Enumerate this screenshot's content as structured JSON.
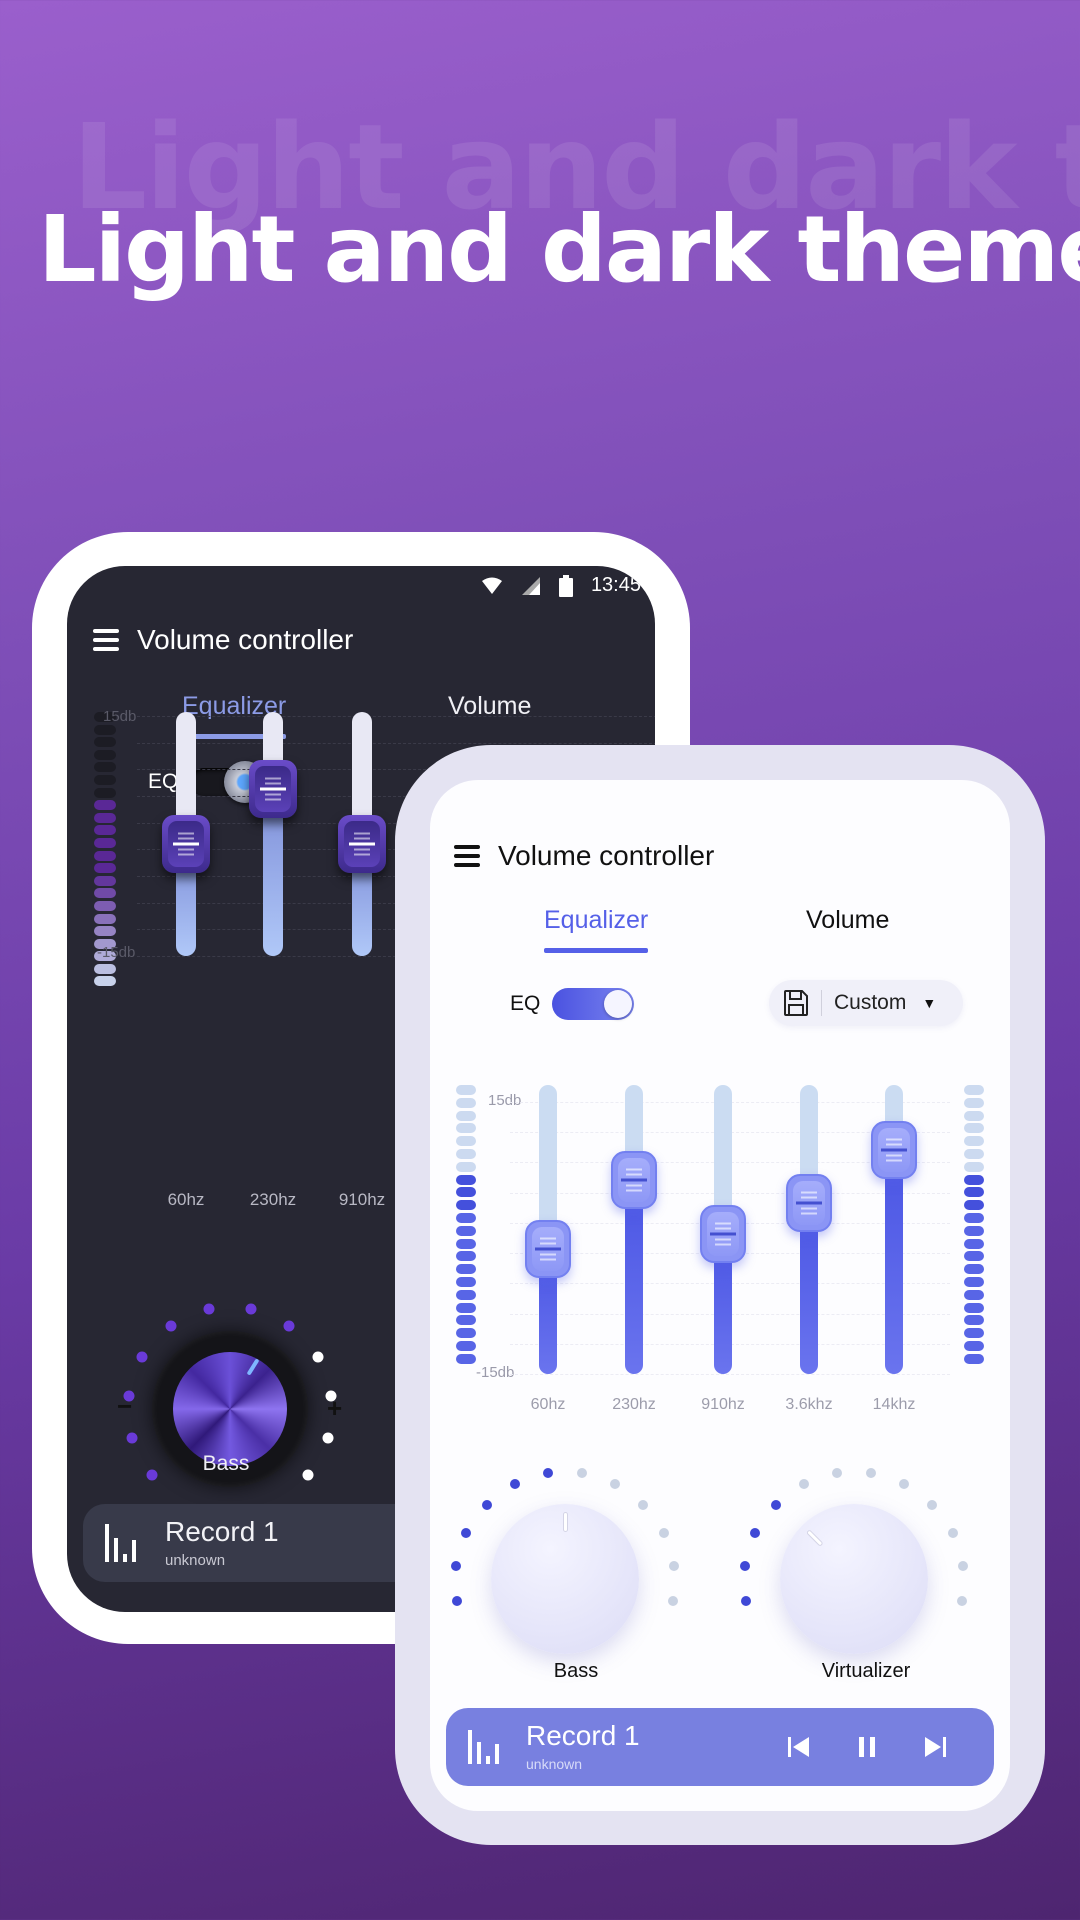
{
  "headline": "Light and dark themes",
  "dark_phone": {
    "status": {
      "time": "13:45",
      "icons": [
        "wifi-icon",
        "cellular-signal-icon",
        "battery-icon"
      ]
    },
    "app_title": "Volume controller",
    "tabs": [
      {
        "label": "Equalizer",
        "active": true
      },
      {
        "label": "Volume",
        "active": false
      }
    ],
    "eq_label": "EQ",
    "eq_enabled": true,
    "scale": {
      "max_label": "15db",
      "min_label": "-15db",
      "max_db": 15,
      "min_db": -15
    },
    "bands": [
      {
        "freq": "60hz",
        "db": 0
      },
      {
        "freq": "230hz",
        "db": 9
      },
      {
        "freq": "910hz",
        "db": 0
      }
    ],
    "level_meter": {
      "total": 22,
      "active": 15
    },
    "bass_knob": {
      "label": "Bass",
      "minus": "−",
      "plus": "+",
      "total_dots": 12,
      "active_dots": 8
    },
    "player": {
      "title": "Record 1",
      "subtitle": "unknown"
    }
  },
  "light_phone": {
    "app_title": "Volume controller",
    "tabs": [
      {
        "label": "Equalizer",
        "active": true
      },
      {
        "label": "Volume",
        "active": false
      }
    ],
    "eq_label": "EQ",
    "eq_enabled": true,
    "preset": {
      "label": "Custom",
      "caret": "▼"
    },
    "scale": {
      "max_label": "15db",
      "min_label": "-15db",
      "max_db": 15,
      "min_db": -15
    },
    "bands": [
      {
        "freq": "60hz",
        "db": -1
      },
      {
        "freq": "230hz",
        "db": 8
      },
      {
        "freq": "910hz",
        "db": 1
      },
      {
        "freq": "3.6khz",
        "db": 5
      },
      {
        "freq": "14khz",
        "db": 12
      }
    ],
    "level_meter_left": {
      "total": 22,
      "active": 15
    },
    "level_meter_right": {
      "total": 22,
      "active": 15
    },
    "knobs": [
      {
        "label": "Bass",
        "total_dots": 12,
        "active_dots": 6
      },
      {
        "label": "Virtualizer",
        "total_dots": 12,
        "active_dots": 4
      }
    ],
    "player": {
      "title": "Record 1",
      "subtitle": "unknown"
    }
  },
  "colors": {
    "accent_light": "#5560e8",
    "accent_dark": "#8c9be6",
    "knob_dot_dark_active": "#6a3ad8",
    "knob_dot_light_active": "#3f48d6",
    "player_light_bg": "#7880e0"
  }
}
